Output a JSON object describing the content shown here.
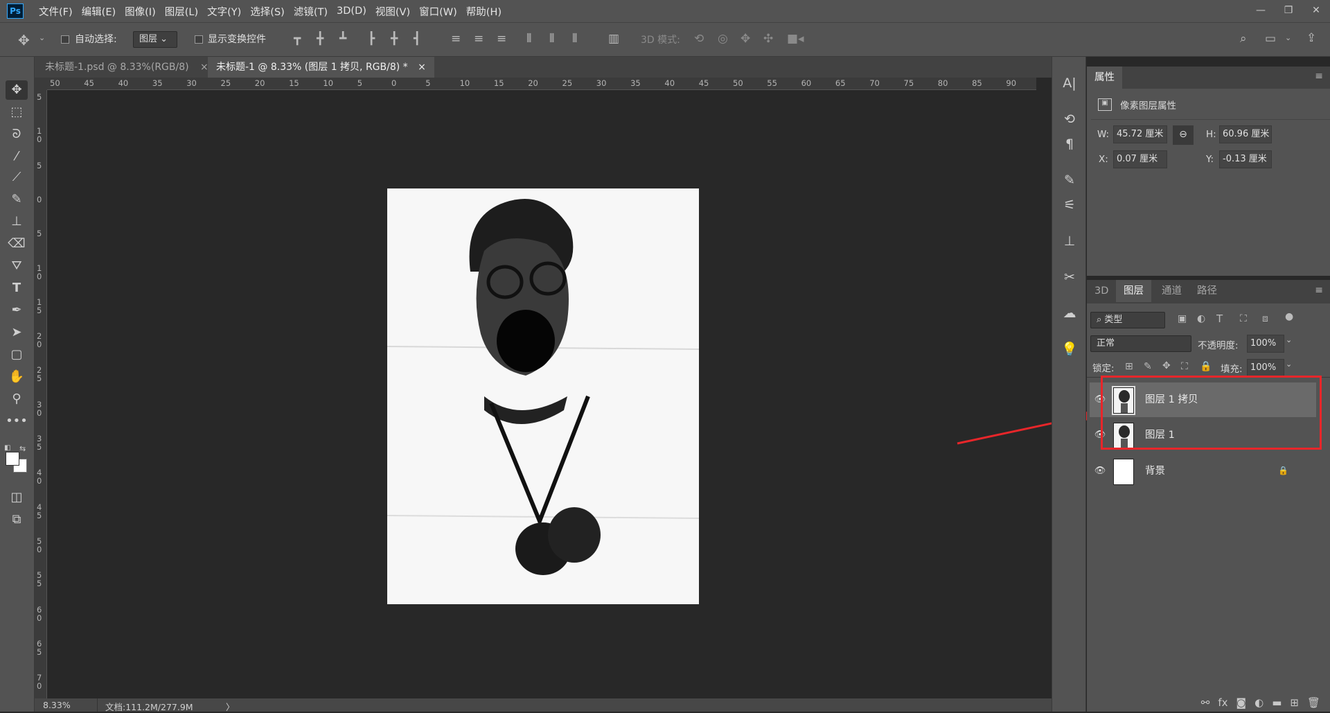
{
  "menu": [
    "文件(F)",
    "编辑(E)",
    "图像(I)",
    "图层(L)",
    "文字(Y)",
    "选择(S)",
    "滤镜(T)",
    "3D(D)",
    "视图(V)",
    "窗口(W)",
    "帮助(H)"
  ],
  "app_logo": "Ps",
  "window_controls": [
    "—",
    "❐",
    "✕"
  ],
  "options": {
    "auto_select_label": "自动选择:",
    "auto_select_value": "图层",
    "show_transform_label": "显示变换控件",
    "mode_3d_label": "3D 模式:"
  },
  "tabs": [
    {
      "title": "未标题-1.psd @ 8.33%(RGB/8)",
      "close": "×"
    },
    {
      "title": "未标题-1 @ 8.33% (图层 1 拷贝, RGB/8) *",
      "close": "×"
    }
  ],
  "rulers": {
    "h": [
      "50",
      "45",
      "40",
      "35",
      "30",
      "25",
      "20",
      "15",
      "10",
      "5",
      "0",
      "5",
      "10",
      "15",
      "20",
      "25",
      "30",
      "35",
      "40",
      "45",
      "50",
      "55",
      "60",
      "65",
      "70",
      "75",
      "80",
      "85",
      "90"
    ],
    "v": [
      "5",
      "1 0",
      "5",
      "0",
      "5",
      "1 0",
      "1 5",
      "2 0",
      "2 5",
      "3 0",
      "3 5",
      "4 0",
      "4 5",
      "5 0",
      "5 5",
      "6 0",
      "6 5",
      "7 0"
    ]
  },
  "status": {
    "zoom": "8.33%",
    "doc": "文档:111.2M/277.9M",
    "arrow": "〉"
  },
  "properties": {
    "tab": "属性",
    "header": "像素图层属性",
    "w_label": "W:",
    "w": "45.72 厘米",
    "h_label": "H:",
    "h": "60.96 厘米",
    "x_label": "X:",
    "x": "0.07 厘米",
    "y_label": "Y:",
    "y": "-0.13 厘米"
  },
  "layers_panel": {
    "tabs": [
      "3D",
      "图层",
      "通道",
      "路径"
    ],
    "active_tab": "图层",
    "filter": "类型",
    "blend": "正常",
    "opacity_label": "不透明度:",
    "opacity": "100%",
    "lock_label": "锁定:",
    "fill_label": "填充:",
    "fill": "100%",
    "layers": [
      {
        "name": "图层 1 拷贝",
        "visible": true,
        "selected": true
      },
      {
        "name": "图层 1",
        "visible": true,
        "selected": false
      },
      {
        "name": "背景",
        "visible": true,
        "selected": false,
        "locked": true
      }
    ]
  },
  "colors": {
    "accent_red": "#e8262a",
    "ps_blue": "#31a8ff"
  }
}
